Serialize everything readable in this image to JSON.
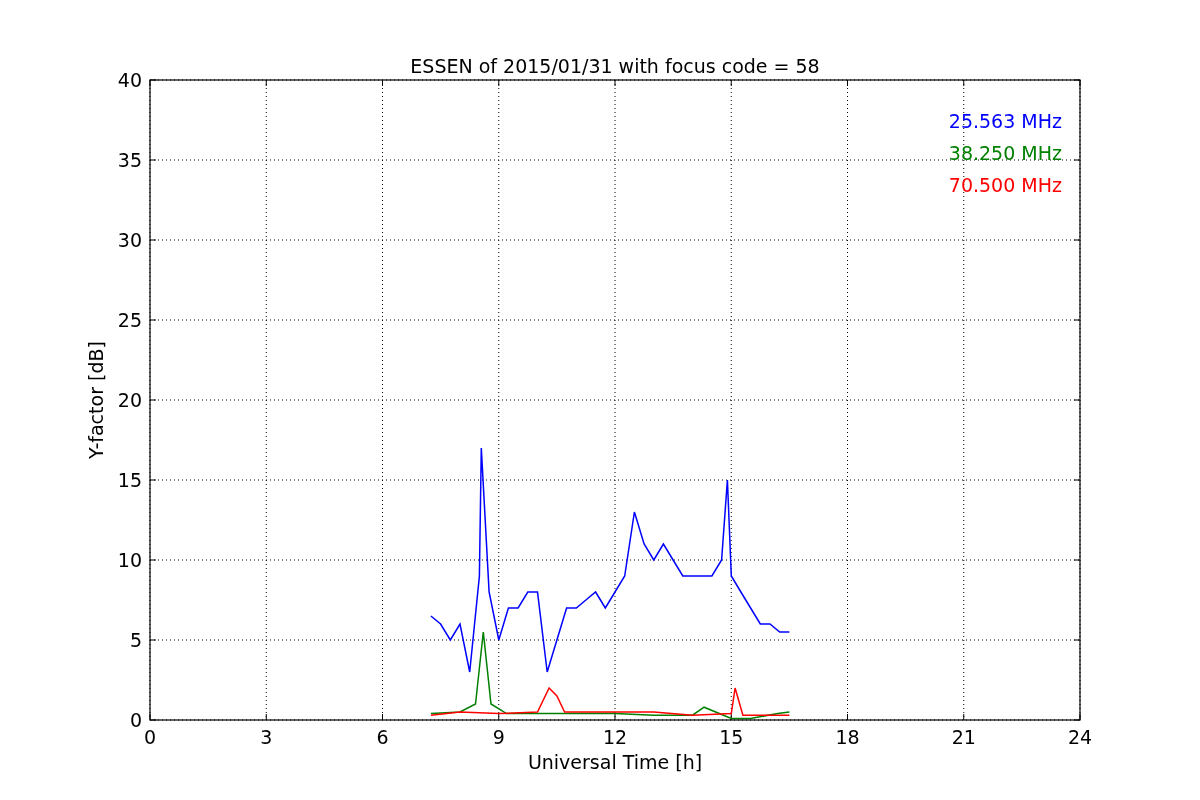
{
  "figure": {
    "chart_data": {
      "type": "line",
      "grid": true,
      "title": "ESSEN of 2015/01/31 with focus code = 58",
      "xlabel": "Universal Time [h]",
      "ylabel": "Y-factor [dB]",
      "xlim": [
        0,
        24
      ],
      "ylim": [
        0,
        40
      ],
      "xticks": [
        0,
        3,
        6,
        9,
        12,
        15,
        18,
        21,
        24
      ],
      "yticks": [
        0,
        5,
        10,
        15,
        20,
        25,
        30,
        35,
        40
      ],
      "series": [
        {
          "name": "25.563 MHz",
          "color": "#0000ff",
          "x": [
            7.25,
            7.5,
            7.75,
            8.0,
            8.25,
            8.5,
            8.55,
            8.75,
            9.0,
            9.25,
            9.5,
            9.75,
            10.0,
            10.25,
            10.5,
            10.75,
            11.0,
            11.25,
            11.5,
            11.75,
            12.0,
            12.25,
            12.5,
            12.75,
            13.0,
            13.25,
            13.5,
            13.75,
            14.0,
            14.25,
            14.5,
            14.75,
            14.9,
            15.0,
            15.25,
            15.5,
            15.75,
            16.0,
            16.25,
            16.5
          ],
          "values": [
            6.5,
            6,
            5,
            6,
            3,
            9,
            17,
            8,
            5,
            7,
            7,
            8,
            8,
            3,
            5,
            7,
            7,
            7.5,
            8,
            7,
            8,
            9,
            13,
            11,
            10,
            11,
            10,
            9,
            9,
            9,
            9,
            10,
            15,
            9,
            8,
            7,
            6,
            6,
            5.5,
            5.5
          ]
        },
        {
          "name": "38.250 MHz",
          "color": "#008000",
          "x": [
            7.25,
            8.0,
            8.4,
            8.6,
            8.8,
            9.2,
            10,
            11,
            12,
            13,
            14,
            14.3,
            15,
            15.5,
            16.2,
            16.5
          ],
          "values": [
            0.4,
            0.5,
            1,
            5.5,
            1,
            0.4,
            0.4,
            0.4,
            0.4,
            0.3,
            0.3,
            0.8,
            0.1,
            0.1,
            0.4,
            0.5
          ]
        },
        {
          "name": "70.500 MHz",
          "color": "#ff0000",
          "x": [
            7.25,
            8,
            9,
            10,
            10.3,
            10.5,
            10.7,
            12,
            13,
            14,
            15,
            15.1,
            15.3,
            15.9,
            16.5
          ],
          "values": [
            0.3,
            0.5,
            0.4,
            0.5,
            2,
            1.5,
            0.5,
            0.5,
            0.5,
            0.3,
            0.4,
            2,
            0.3,
            0.3,
            0.3
          ]
        }
      ]
    }
  }
}
